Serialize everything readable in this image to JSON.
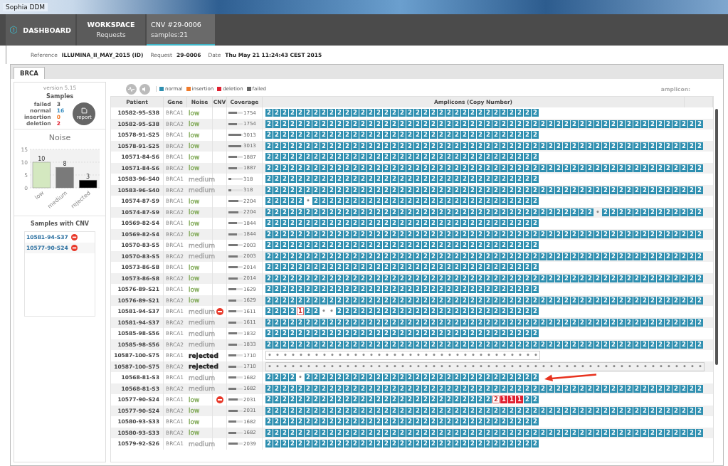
{
  "window": {
    "title": "Sophia DDM"
  },
  "nav": [
    {
      "kind": "logo",
      "title": "DASHBOARD",
      "selected": false
    },
    {
      "kind": "tile",
      "title": "WORKSPACE",
      "subtitle": "Requests",
      "selected": false
    },
    {
      "kind": "tile",
      "title": "CNV #29-0006",
      "subtitle": "samples:21",
      "selected": true
    }
  ],
  "info": [
    {
      "label": "Reference",
      "value": "ILLUMINA_II_MAY_2015 (ID)"
    },
    {
      "label": "Request",
      "value": "29-0006"
    },
    {
      "label": "Date",
      "value": "Thu May 21 11:24:43 CEST 2015"
    }
  ],
  "tabs": [
    {
      "label": "BRCA",
      "selected": true
    }
  ],
  "sidebar": {
    "version": "version 5.15",
    "samples_title": "Samples",
    "samples": [
      {
        "label": "failed",
        "count": "3",
        "color": "#555555"
      },
      {
        "label": "normal",
        "count": "16",
        "color": "#3a8fc0"
      },
      {
        "label": "insertion",
        "count": "0",
        "color": "#f07a2a"
      },
      {
        "label": "deletion",
        "count": "2",
        "color": "#e02030"
      }
    ],
    "report_button": "report",
    "noise_chart": {
      "title": "Noise",
      "chart_data": {
        "type": "bar",
        "categories": [
          "low",
          "medium",
          "rejected"
        ],
        "values": [
          10,
          8,
          3
        ],
        "yticks": [
          0,
          5,
          10,
          15
        ],
        "ylim": [
          0,
          15
        ],
        "data_labels": true,
        "colors": [
          "#d4e8c0",
          "#7a7a7a",
          "#000000"
        ]
      }
    },
    "cnv_title": "Samples with CNV",
    "cnv_samples": [
      "10581-94-S37",
      "10577-90-S24"
    ]
  },
  "legend": [
    {
      "label": "normal",
      "color": "#2e8fb0"
    },
    {
      "label": "insertion",
      "color": "#f07a2a"
    },
    {
      "label": "deletion",
      "color": "#e02030"
    },
    {
      "label": "failed",
      "color": "#666666"
    }
  ],
  "amplicon_label": "amplicon:",
  "table": {
    "columns": [
      "Patient",
      "Gene",
      "Noise",
      "CNV",
      "Coverage",
      "Amplicons (Copy Number)"
    ],
    "rows": [
      {
        "patient": "10582-95-S38",
        "gene": "BRCA1",
        "noise": {
          "text": "low",
          "color": "#7fa855",
          "bold": false
        },
        "cnv": false,
        "coverage": "1754",
        "level": 0.58,
        "amplicons": [
          "2",
          "2",
          "2",
          "2",
          "2",
          "2",
          "2",
          "2",
          "2",
          "2",
          "2",
          "2",
          "2",
          "2",
          "2",
          "2",
          "2",
          "2",
          "2",
          "2",
          "2",
          "2",
          "2",
          "2",
          "2",
          "2",
          "2",
          "2",
          "2",
          "2",
          "2",
          "2",
          "2",
          "2",
          "2"
        ]
      },
      {
        "patient": "10582-95-S38",
        "gene": "BRCA2",
        "noise": {
          "text": "low",
          "color": "#7fa855",
          "bold": false
        },
        "cnv": false,
        "coverage": "1754",
        "level": 0.58,
        "amplicons": [
          "2",
          "2",
          "2",
          "2",
          "2",
          "2",
          "2",
          "2",
          "2",
          "2",
          "2",
          "2",
          "2",
          "2",
          "2",
          "2",
          "2",
          "2",
          "2",
          "2",
          "2",
          "2",
          "2",
          "2",
          "2",
          "2",
          "2",
          "2",
          "2",
          "2",
          "2",
          "2",
          "2",
          "2",
          "2",
          "2",
          "2",
          "2",
          "2",
          "2",
          "2",
          "2",
          "2",
          "2",
          "2",
          "2",
          "2",
          "2",
          "2",
          "2",
          "2",
          "2",
          "2",
          "2",
          "2",
          "2"
        ]
      },
      {
        "patient": "10578-91-S25",
        "gene": "BRCA1",
        "noise": {
          "text": "low",
          "color": "#7fa855",
          "bold": false
        },
        "cnv": false,
        "coverage": "3013",
        "level": 0.92,
        "amplicons": [
          "2",
          "2",
          "2",
          "2",
          "2",
          "2",
          "2",
          "2",
          "2",
          "2",
          "2",
          "2",
          "2",
          "2",
          "2",
          "2",
          "2",
          "2",
          "2",
          "2",
          "2",
          "2",
          "2",
          "2",
          "2",
          "2",
          "2",
          "2",
          "2",
          "2",
          "2",
          "2",
          "2",
          "2",
          "2"
        ]
      },
      {
        "patient": "10578-91-S25",
        "gene": "BRCA2",
        "noise": {
          "text": "low",
          "color": "#7fa855",
          "bold": false
        },
        "cnv": false,
        "coverage": "3013",
        "level": 0.92,
        "amplicons": [
          "2",
          "2",
          "2",
          "2",
          "2",
          "2",
          "2",
          "2",
          "2",
          "2",
          "2",
          "2",
          "2",
          "2",
          "2",
          "2",
          "2",
          "2",
          "2",
          "2",
          "2",
          "2",
          "2",
          "2",
          "2",
          "2",
          "2",
          "2",
          "2",
          "2",
          "2",
          "2",
          "2",
          "2",
          "2",
          "2",
          "2",
          "2",
          "2",
          "2",
          "2",
          "2",
          "2",
          "2",
          "2",
          "2",
          "2",
          "2",
          "2",
          "2",
          "2",
          "2",
          "2",
          "2",
          "2",
          "2"
        ]
      },
      {
        "patient": "10571-84-S6",
        "gene": "BRCA1",
        "noise": {
          "text": "low",
          "color": "#7fa855",
          "bold": false
        },
        "cnv": false,
        "coverage": "1887",
        "level": 0.62,
        "amplicons": [
          "2",
          "2",
          "2",
          "2",
          "2",
          "2",
          "2",
          "2",
          "2",
          "2",
          "2",
          "2",
          "2",
          "2",
          "2",
          "2",
          "2",
          "2",
          "2",
          "2",
          "2",
          "2",
          "2",
          "2",
          "2",
          "2",
          "2",
          "2",
          "2",
          "2",
          "2",
          "2",
          "2",
          "2",
          "2"
        ]
      },
      {
        "patient": "10571-84-S6",
        "gene": "BRCA2",
        "noise": {
          "text": "low",
          "color": "#7fa855",
          "bold": false
        },
        "cnv": false,
        "coverage": "1887",
        "level": 0.62,
        "amplicons": [
          "2",
          "2",
          "2",
          "2",
          "2",
          "2",
          "2",
          "2",
          "2",
          "2",
          "2",
          "2",
          "2",
          "2",
          "2",
          "2",
          "2",
          "2",
          "2",
          "2",
          "2",
          "2",
          "2",
          "2",
          "2",
          "2",
          "2",
          "2",
          "2",
          "2",
          "2",
          "2",
          "2",
          "2",
          "2",
          "2",
          "2",
          "2",
          "2",
          "2",
          "2",
          "2",
          "2",
          "2",
          "2",
          "2",
          "2",
          "2",
          "2",
          "2",
          "2",
          "2",
          "2",
          "2",
          "2",
          "2"
        ]
      },
      {
        "patient": "10583-96-S40",
        "gene": "BRCA1",
        "noise": {
          "text": "medium",
          "color": "#a0a0a0",
          "bold": false
        },
        "cnv": false,
        "coverage": "318",
        "level": 0.18,
        "amplicons": [
          "2",
          "2",
          "2",
          "2",
          "2",
          "2",
          "2",
          "2",
          "2",
          "2",
          "2",
          "2",
          "2",
          "2",
          "2",
          "2",
          "2",
          "2",
          "2",
          "2",
          "2",
          "2",
          "2",
          "2",
          "2",
          "2",
          "2",
          "2",
          "2",
          "2",
          "2",
          "2",
          "2",
          "2",
          "2"
        ]
      },
      {
        "patient": "10583-96-S40",
        "gene": "BRCA2",
        "noise": {
          "text": "medium",
          "color": "#a0a0a0",
          "bold": false
        },
        "cnv": false,
        "coverage": "318",
        "level": 0.18,
        "amplicons": [
          "2",
          "2",
          "2",
          "2",
          "2",
          "2",
          "2",
          "2",
          "2",
          "2",
          "2",
          "2",
          "2",
          "2",
          "2",
          "2",
          "2",
          "2",
          "2",
          "2",
          "2",
          "2",
          "2",
          "2",
          "2",
          "2",
          "2",
          "2",
          "2",
          "2",
          "2",
          "2",
          "2",
          "2",
          "2",
          "2",
          "2",
          "2",
          "2",
          "2",
          "2",
          "2",
          "2",
          "2",
          "2",
          "2",
          "2",
          "2",
          "2",
          "2",
          "2",
          "2",
          "2",
          "2",
          "2",
          "2"
        ]
      },
      {
        "patient": "10574-87-S9",
        "gene": "BRCA1",
        "noise": {
          "text": "low",
          "color": "#7fa855",
          "bold": false
        },
        "cnv": false,
        "coverage": "2204",
        "level": 0.72,
        "amplicons": [
          "2",
          "2",
          "2",
          "2",
          "2",
          {
            "text": "•",
            "kind": "failed"
          },
          "2",
          "2",
          "2",
          "2",
          "2",
          "2",
          "2",
          "2",
          "2",
          "2",
          "2",
          "2",
          "2",
          "2",
          "2",
          "2",
          "2",
          "2",
          "2",
          "2",
          "2",
          "2",
          "2",
          "2",
          "2",
          "2",
          "2",
          "2",
          "2"
        ]
      },
      {
        "patient": "10574-87-S9",
        "gene": "BRCA2",
        "noise": {
          "text": "low",
          "color": "#7fa855",
          "bold": false
        },
        "cnv": false,
        "coverage": "2204",
        "level": 0.72,
        "amplicons": [
          "2",
          "2",
          "2",
          "2",
          "2",
          "2",
          "2",
          "2",
          "2",
          "2",
          "2",
          "2",
          "2",
          "2",
          "2",
          "2",
          "2",
          "2",
          "2",
          "2",
          "2",
          "2",
          "2",
          "2",
          "2",
          "2",
          "2",
          "2",
          "2",
          "2",
          "2",
          "2",
          "2",
          "2",
          "2",
          "2",
          "2",
          "2",
          "2",
          "2",
          "2",
          "2",
          {
            "text": "•",
            "kind": "failed"
          },
          "2",
          "2",
          "2",
          "2",
          "2",
          "2",
          "2",
          "2",
          "2",
          "2",
          "2",
          "2",
          "2"
        ]
      },
      {
        "patient": "10569-82-S4",
        "gene": "BRCA1",
        "noise": {
          "text": "low",
          "color": "#7fa855",
          "bold": false
        },
        "cnv": false,
        "coverage": "1844",
        "level": 0.6,
        "amplicons": [
          "2",
          "2",
          "2",
          "2",
          "2",
          "2",
          "2",
          "2",
          "2",
          "2",
          "2",
          "2",
          "2",
          "2",
          "2",
          "2",
          "2",
          "2",
          "2",
          "2",
          "2",
          "2",
          "2",
          "2",
          "2",
          "2",
          "2",
          "2",
          "2",
          "2",
          "2",
          "2",
          "2",
          "2",
          "2"
        ]
      },
      {
        "patient": "10569-82-S4",
        "gene": "BRCA2",
        "noise": {
          "text": "low",
          "color": "#7fa855",
          "bold": false
        },
        "cnv": false,
        "coverage": "1844",
        "level": 0.6,
        "amplicons": [
          "2",
          "2",
          "2",
          "2",
          "2",
          "2",
          "2",
          "2",
          "2",
          "2",
          "2",
          "2",
          "2",
          "2",
          "2",
          "2",
          "2",
          "2",
          "2",
          "2",
          "2",
          "2",
          "2",
          "2",
          "2",
          "2",
          "2",
          "2",
          "2",
          "2",
          "2",
          "2",
          "2",
          "2",
          "2",
          "2",
          "2",
          "2",
          "2",
          "2",
          "2",
          "2",
          "2",
          "2",
          "2",
          "2",
          "2",
          "2",
          "2",
          "2",
          "2",
          "2",
          "2",
          "2",
          "2",
          "2"
        ]
      },
      {
        "patient": "10570-83-S5",
        "gene": "BRCA1",
        "noise": {
          "text": "medium",
          "color": "#a0a0a0",
          "bold": false
        },
        "cnv": false,
        "coverage": "2003",
        "level": 0.65,
        "amplicons": [
          "2",
          "2",
          "2",
          "2",
          "2",
          "2",
          "2",
          "2",
          "2",
          "2",
          "2",
          "2",
          "2",
          "2",
          "2",
          "2",
          "2",
          "2",
          "2",
          "2",
          "2",
          "2",
          "2",
          "2",
          "2",
          "2",
          "2",
          "2",
          "2",
          "2",
          "2",
          "2",
          "2",
          "2",
          "2"
        ]
      },
      {
        "patient": "10570-83-S5",
        "gene": "BRCA2",
        "noise": {
          "text": "medium",
          "color": "#a0a0a0",
          "bold": false
        },
        "cnv": false,
        "coverage": "2003",
        "level": 0.65,
        "amplicons": [
          "2",
          "2",
          "2",
          "2",
          "2",
          "2",
          "2",
          "2",
          "2",
          "2",
          "2",
          "2",
          "2",
          "2",
          "2",
          "2",
          "2",
          "2",
          "2",
          "2",
          "2",
          "2",
          "2",
          "2",
          "2",
          "2",
          "2",
          "2",
          "2",
          "2",
          "2",
          "2",
          "2",
          "2",
          "2",
          "2",
          "2",
          "2",
          "2",
          "2",
          "2",
          "2",
          "2",
          "2",
          "2",
          "2",
          "2",
          "2",
          "2",
          "2",
          "2",
          "2",
          "2",
          "2",
          "2",
          "2"
        ]
      },
      {
        "patient": "10573-86-S8",
        "gene": "BRCA1",
        "noise": {
          "text": "low",
          "color": "#7fa855",
          "bold": false
        },
        "cnv": false,
        "coverage": "2014",
        "level": 0.66,
        "amplicons": [
          "2",
          "2",
          "2",
          "2",
          "2",
          "2",
          "2",
          "2",
          "2",
          "2",
          "2",
          "2",
          "2",
          "2",
          "2",
          "2",
          "2",
          "2",
          "2",
          "2",
          "2",
          "2",
          "2",
          "2",
          "2",
          "2",
          "2",
          "2",
          "2",
          "2",
          "2",
          "2",
          "2",
          "2",
          "2"
        ]
      },
      {
        "patient": "10573-86-S8",
        "gene": "BRCA2",
        "noise": {
          "text": "low",
          "color": "#7fa855",
          "bold": false
        },
        "cnv": false,
        "coverage": "2014",
        "level": 0.66,
        "amplicons": [
          "2",
          "2",
          "2",
          "2",
          "2",
          "2",
          "2",
          "2",
          "2",
          "2",
          "2",
          "2",
          "2",
          "2",
          "2",
          "2",
          "2",
          "2",
          "2",
          "2",
          "2",
          "2",
          "2",
          "2",
          "2",
          "2",
          "2",
          "2",
          "2",
          "2",
          "2",
          "2",
          "2",
          "2",
          "2",
          "2",
          "2",
          "2",
          "2",
          "2",
          "2",
          "2",
          "2",
          "2",
          "2",
          "2",
          "2",
          "2",
          "2",
          "2",
          "2",
          "2",
          "2",
          "2",
          "2",
          "2"
        ]
      },
      {
        "patient": "10576-89-S21",
        "gene": "BRCA1",
        "noise": {
          "text": "low",
          "color": "#7fa855",
          "bold": false
        },
        "cnv": false,
        "coverage": "1629",
        "level": 0.55,
        "amplicons": [
          "2",
          "2",
          "2",
          "2",
          "2",
          "2",
          "2",
          "2",
          "2",
          "2",
          "2",
          "2",
          "2",
          "2",
          "2",
          "2",
          "2",
          "2",
          "2",
          "2",
          "2",
          "2",
          "2",
          "2",
          "2",
          "2",
          "2",
          "2",
          "2",
          "2",
          "2",
          "2",
          "2",
          "2",
          "2"
        ]
      },
      {
        "patient": "10576-89-S21",
        "gene": "BRCA2",
        "noise": {
          "text": "low",
          "color": "#7fa855",
          "bold": false
        },
        "cnv": false,
        "coverage": "1629",
        "level": 0.55,
        "amplicons": [
          "2",
          "2",
          "2",
          "2",
          "2",
          "2",
          "2",
          "2",
          "2",
          "2",
          "2",
          "2",
          "2",
          "2",
          "2",
          "2",
          "2",
          "2",
          "2",
          "2",
          "2",
          "2",
          "2",
          "2",
          "2",
          "2",
          "2",
          "2",
          "2",
          "2",
          "2",
          "2",
          "2",
          "2",
          "2",
          "2",
          "2",
          "2",
          "2",
          "2",
          "2",
          "2",
          "2",
          "2",
          "2",
          "2",
          "2",
          "2",
          "2",
          "2",
          "2",
          "2",
          "2",
          "2",
          "2",
          "2"
        ]
      },
      {
        "patient": "10581-94-S37",
        "gene": "BRCA1",
        "noise": {
          "text": "medium",
          "color": "#a0a0a0",
          "bold": false
        },
        "cnv": true,
        "coverage": "1611",
        "level": 0.55,
        "amplicons": [
          "2",
          "2",
          "2",
          "2",
          {
            "text": "1",
            "kind": "outlined"
          },
          "2",
          "2",
          {
            "text": "•",
            "kind": "failed"
          },
          {
            "text": "•",
            "kind": "failed"
          },
          "2",
          "2",
          "2",
          "2",
          "2",
          "2",
          "2",
          "2",
          "2",
          "2",
          "2",
          "2",
          "2",
          "2",
          "2",
          "2",
          "2",
          "2",
          "2",
          "2",
          "2",
          "2",
          "2",
          "2",
          "2",
          "2"
        ]
      },
      {
        "patient": "10581-94-S37",
        "gene": "BRCA2",
        "noise": {
          "text": "medium",
          "color": "#a0a0a0",
          "bold": false
        },
        "cnv": false,
        "coverage": "1611",
        "level": 0.55,
        "amplicons": [
          "2",
          "2",
          "2",
          "2",
          "2",
          "2",
          "2",
          "2",
          "2",
          "2",
          "2",
          "2",
          "2",
          "2",
          "2",
          "2",
          "2",
          "2",
          "2",
          "2",
          "2",
          "2",
          "2",
          "2",
          "2",
          "2",
          "2",
          "2",
          "2",
          "2",
          "2",
          "2",
          "2",
          "2",
          "2",
          "2",
          "2",
          "2",
          "2",
          "2",
          "2",
          "2",
          "2",
          "2",
          "2",
          "2",
          "2",
          "2",
          "2",
          "2",
          "2",
          "2",
          "2",
          "2",
          "2",
          "2"
        ]
      },
      {
        "patient": "10585-98-S56",
        "gene": "BRCA1",
        "noise": {
          "text": "medium",
          "color": "#a0a0a0",
          "bold": false
        },
        "cnv": false,
        "coverage": "1832",
        "level": 0.6,
        "amplicons": [
          "2",
          "2",
          "2",
          "2",
          "2",
          "2",
          "2",
          "2",
          "2",
          "2",
          "2",
          "2",
          "2",
          "2",
          "2",
          "2",
          "2",
          "2",
          "2",
          "2",
          "2",
          "2",
          "2",
          "2",
          "2",
          "2",
          "2",
          "2",
          "2",
          "2",
          "2",
          "2",
          "2",
          "2",
          "2"
        ]
      },
      {
        "patient": "10585-98-S56",
        "gene": "BRCA2",
        "noise": {
          "text": "medium",
          "color": "#a0a0a0",
          "bold": false
        },
        "cnv": false,
        "coverage": "1833",
        "level": 0.6,
        "amplicons": [
          "2",
          "2",
          "2",
          "2",
          "2",
          "2",
          "2",
          "2",
          "2",
          "2",
          "2",
          "2",
          "2",
          "2",
          "2",
          "2",
          "2",
          "2",
          "2",
          "2",
          "2",
          "2",
          "2",
          "2",
          "2",
          "2",
          "2",
          "2",
          "2",
          "2",
          "2",
          "2",
          "2",
          "2",
          "2",
          "2",
          "2",
          "2",
          "2",
          "2",
          "2",
          "2",
          "2",
          "2",
          "2",
          "2",
          "2",
          "2",
          "2",
          "2",
          "2",
          "2",
          "2",
          "2",
          "2",
          "2"
        ]
      },
      {
        "patient": "10587-100-S75",
        "gene": "BRCA1",
        "noise": {
          "text": "rejected",
          "color": "#222222",
          "bold": true
        },
        "cnv": false,
        "coverage": "1710",
        "level": 0.57,
        "amplicons": [
          {
            "text": "•",
            "kind": "failed"
          },
          {
            "text": "•",
            "kind": "failed"
          },
          {
            "text": "•",
            "kind": "failed"
          },
          {
            "text": "•",
            "kind": "failed"
          },
          {
            "text": "•",
            "kind": "failed"
          },
          {
            "text": "•",
            "kind": "failed"
          },
          {
            "text": "•",
            "kind": "failed"
          },
          {
            "text": "•",
            "kind": "failed"
          },
          {
            "text": "•",
            "kind": "failed"
          },
          {
            "text": "•",
            "kind": "failed"
          },
          {
            "text": "•",
            "kind": "failed"
          },
          {
            "text": "•",
            "kind": "failed"
          },
          {
            "text": "•",
            "kind": "failed"
          },
          {
            "text": "•",
            "kind": "failed"
          },
          {
            "text": "•",
            "kind": "failed"
          },
          {
            "text": "•",
            "kind": "failed"
          },
          {
            "text": "•",
            "kind": "failed"
          },
          {
            "text": "•",
            "kind": "failed"
          },
          {
            "text": "•",
            "kind": "failed"
          },
          {
            "text": "•",
            "kind": "failed"
          },
          {
            "text": "•",
            "kind": "failed"
          },
          {
            "text": "•",
            "kind": "failed"
          },
          {
            "text": "•",
            "kind": "failed"
          },
          {
            "text": "•",
            "kind": "failed"
          },
          {
            "text": "•",
            "kind": "failed"
          },
          {
            "text": "•",
            "kind": "failed"
          },
          {
            "text": "•",
            "kind": "failed"
          },
          {
            "text": "•",
            "kind": "failed"
          },
          {
            "text": "•",
            "kind": "failed"
          },
          {
            "text": "•",
            "kind": "failed"
          },
          {
            "text": "•",
            "kind": "failed"
          },
          {
            "text": "•",
            "kind": "failed"
          },
          {
            "text": "•",
            "kind": "failed"
          },
          {
            "text": "•",
            "kind": "failed"
          },
          {
            "text": "•",
            "kind": "failed"
          }
        ]
      },
      {
        "patient": "10587-100-S75",
        "gene": "BRCA2",
        "noise": {
          "text": "rejected",
          "color": "#222222",
          "bold": true
        },
        "cnv": false,
        "coverage": "1710",
        "level": 0.57,
        "amplicons": [
          {
            "text": "•",
            "kind": "failed"
          },
          {
            "text": "•",
            "kind": "failed"
          },
          {
            "text": "•",
            "kind": "failed"
          },
          {
            "text": "•",
            "kind": "failed"
          },
          {
            "text": "•",
            "kind": "failed"
          },
          {
            "text": "•",
            "kind": "failed"
          },
          {
            "text": "•",
            "kind": "failed"
          },
          {
            "text": "•",
            "kind": "failed"
          },
          {
            "text": "•",
            "kind": "failed"
          },
          {
            "text": "•",
            "kind": "failed"
          },
          {
            "text": "•",
            "kind": "failed"
          },
          {
            "text": "•",
            "kind": "failed"
          },
          {
            "text": "•",
            "kind": "failed"
          },
          {
            "text": "•",
            "kind": "failed"
          },
          {
            "text": "•",
            "kind": "failed"
          },
          {
            "text": "•",
            "kind": "failed"
          },
          {
            "text": "•",
            "kind": "failed"
          },
          {
            "text": "•",
            "kind": "failed"
          },
          {
            "text": "•",
            "kind": "failed"
          },
          {
            "text": "•",
            "kind": "failed"
          },
          {
            "text": "•",
            "kind": "failed"
          },
          {
            "text": "•",
            "kind": "failed"
          },
          {
            "text": "•",
            "kind": "failed"
          },
          {
            "text": "•",
            "kind": "failed"
          },
          {
            "text": "•",
            "kind": "failed"
          },
          {
            "text": "•",
            "kind": "failed"
          },
          {
            "text": "•",
            "kind": "failed"
          },
          {
            "text": "•",
            "kind": "failed"
          },
          {
            "text": "•",
            "kind": "failed"
          },
          {
            "text": "•",
            "kind": "failed"
          },
          {
            "text": "•",
            "kind": "failed"
          },
          {
            "text": "•",
            "kind": "failed"
          },
          {
            "text": "•",
            "kind": "failed"
          },
          {
            "text": "•",
            "kind": "failed"
          },
          {
            "text": "•",
            "kind": "failed"
          },
          {
            "text": "•",
            "kind": "failed"
          },
          {
            "text": "•",
            "kind": "failed"
          },
          {
            "text": "•",
            "kind": "failed"
          },
          {
            "text": "•",
            "kind": "failed"
          },
          {
            "text": "•",
            "kind": "failed"
          },
          {
            "text": "•",
            "kind": "failed"
          },
          {
            "text": "•",
            "kind": "failed"
          },
          {
            "text": "•",
            "kind": "failed"
          },
          {
            "text": "•",
            "kind": "failed"
          },
          {
            "text": "•",
            "kind": "failed"
          },
          {
            "text": "•",
            "kind": "failed"
          },
          {
            "text": "•",
            "kind": "failed"
          },
          {
            "text": "•",
            "kind": "failed"
          },
          {
            "text": "•",
            "kind": "failed"
          },
          {
            "text": "•",
            "kind": "failed"
          },
          {
            "text": "•",
            "kind": "failed"
          },
          {
            "text": "•",
            "kind": "failed"
          },
          {
            "text": "•",
            "kind": "failed"
          },
          {
            "text": "•",
            "kind": "failed"
          },
          {
            "text": "•",
            "kind": "failed"
          },
          {
            "text": "•",
            "kind": "failed"
          }
        ]
      },
      {
        "patient": "10568-81-S3",
        "gene": "BRCA1",
        "noise": {
          "text": "medium",
          "color": "#a0a0a0",
          "bold": false
        },
        "cnv": false,
        "coverage": "1682",
        "level": 0.56,
        "amplicons": [
          "2",
          "2",
          "2",
          "2",
          {
            "text": "•",
            "kind": "failed"
          },
          "2",
          "2",
          "2",
          "2",
          "2",
          "2",
          "2",
          "2",
          "2",
          "2",
          "2",
          "2",
          "2",
          "2",
          "2",
          "2",
          "2",
          "2",
          "2",
          "2",
          "2",
          "2",
          "2",
          "2",
          "2",
          "2",
          "2",
          "2",
          "2",
          "2"
        ]
      },
      {
        "patient": "10568-81-S3",
        "gene": "BRCA2",
        "noise": {
          "text": "medium",
          "color": "#a0a0a0",
          "bold": false
        },
        "cnv": false,
        "coverage": "1682",
        "level": 0.56,
        "amplicons": [
          "2",
          "2",
          "2",
          "2",
          "2",
          "2",
          "2",
          "2",
          "2",
          "2",
          "2",
          "2",
          "2",
          "2",
          "2",
          "2",
          "2",
          "2",
          "2",
          "2",
          "2",
          "2",
          "2",
          "2",
          "2",
          "2",
          "2",
          "2",
          "2",
          "2",
          "2",
          "2",
          "2",
          "2",
          "2",
          "2",
          "2",
          "2",
          "2",
          "2",
          "2",
          "2",
          "2",
          "2",
          "2",
          "2",
          "2",
          "2",
          "2",
          "2",
          "2",
          "2",
          "2",
          "2",
          "2",
          "2"
        ]
      },
      {
        "patient": "10577-90-S24",
        "gene": "BRCA1",
        "noise": {
          "text": "low",
          "color": "#7fa855",
          "bold": false
        },
        "cnv": true,
        "coverage": "2031",
        "level": 0.66,
        "amplicons": [
          "2",
          "2",
          "2",
          "2",
          "2",
          "2",
          "2",
          "2",
          "2",
          "2",
          "2",
          "2",
          "2",
          "2",
          "2",
          "2",
          "2",
          "2",
          "2",
          "2",
          "2",
          "2",
          "2",
          "2",
          "2",
          "2",
          "2",
          "2",
          "2",
          {
            "text": "2",
            "kind": "outlined"
          },
          {
            "text": "1",
            "kind": "deletion"
          },
          {
            "text": "1",
            "kind": "deletion"
          },
          {
            "text": "1",
            "kind": "deletion"
          },
          "2",
          "2"
        ]
      },
      {
        "patient": "10577-90-S24",
        "gene": "BRCA2",
        "noise": {
          "text": "low",
          "color": "#7fa855",
          "bold": false
        },
        "cnv": false,
        "coverage": "2031",
        "level": 0.66,
        "amplicons": [
          "2",
          "2",
          "2",
          "2",
          "2",
          "2",
          "2",
          "2",
          "2",
          "2",
          "2",
          "2",
          "2",
          "2",
          "2",
          "2",
          "2",
          "2",
          "2",
          "2",
          "2",
          "2",
          "2",
          "2",
          "2",
          "2",
          "2",
          "2",
          "2",
          "2",
          "2",
          "2",
          "2",
          "2",
          "2",
          "2",
          "2",
          "2",
          "2",
          "2",
          "2",
          "2",
          "2",
          "2",
          "2",
          "2",
          "2",
          "2",
          "2",
          "2",
          "2",
          "2",
          "2",
          "2",
          "2",
          "2"
        ]
      },
      {
        "patient": "10580-93-S33",
        "gene": "BRCA1",
        "noise": {
          "text": "low",
          "color": "#7fa855",
          "bold": false
        },
        "cnv": false,
        "coverage": "1682",
        "level": 0.56,
        "amplicons": [
          "2",
          "2",
          "2",
          "2",
          "2",
          "2",
          "2",
          "2",
          "2",
          "2",
          "2",
          "2",
          "2",
          "2",
          "2",
          "2",
          "2",
          "2",
          "2",
          "2",
          "2",
          "2",
          "2",
          "2",
          "2",
          "2",
          "2",
          "2",
          "2",
          "2",
          "2",
          "2",
          "2",
          "2",
          "2"
        ]
      },
      {
        "patient": "10580-93-S33",
        "gene": "BRCA2",
        "noise": {
          "text": "low",
          "color": "#7fa855",
          "bold": false
        },
        "cnv": false,
        "coverage": "1682",
        "level": 0.56,
        "amplicons": [
          "2",
          "2",
          "2",
          "2",
          "2",
          "2",
          "2",
          "2",
          "2",
          "2",
          "2",
          "2",
          "2",
          "2",
          "2",
          "2",
          "2",
          "2",
          "2",
          "2",
          "2",
          "2",
          "2",
          "2",
          "2",
          "2",
          "2",
          "2",
          "2",
          "2",
          "2",
          "2",
          "2",
          "2",
          "2",
          "2",
          "2",
          "2",
          "2",
          "2",
          "2",
          "2",
          "2",
          "2",
          "2",
          "2",
          "2",
          "2",
          "2",
          "2",
          "2",
          "2",
          "2",
          "2",
          "2",
          "2"
        ]
      },
      {
        "patient": "10579-92-S26",
        "gene": "BRCA1",
        "noise": {
          "text": "medium",
          "color": "#a0a0a0",
          "bold": false
        },
        "cnv": false,
        "coverage": "2039",
        "level": 0.66,
        "amplicons": [
          "2",
          "2",
          "2",
          "2",
          "2",
          "2",
          "2",
          "2",
          "2",
          "2",
          "2",
          "2",
          "2",
          "2",
          "2",
          "2",
          "2",
          "2",
          "2",
          "2",
          "2",
          "2",
          "2",
          "2",
          "2",
          "2",
          "2",
          "2",
          "2",
          "2",
          "2",
          "2",
          "2",
          "2",
          "2"
        ]
      }
    ]
  }
}
